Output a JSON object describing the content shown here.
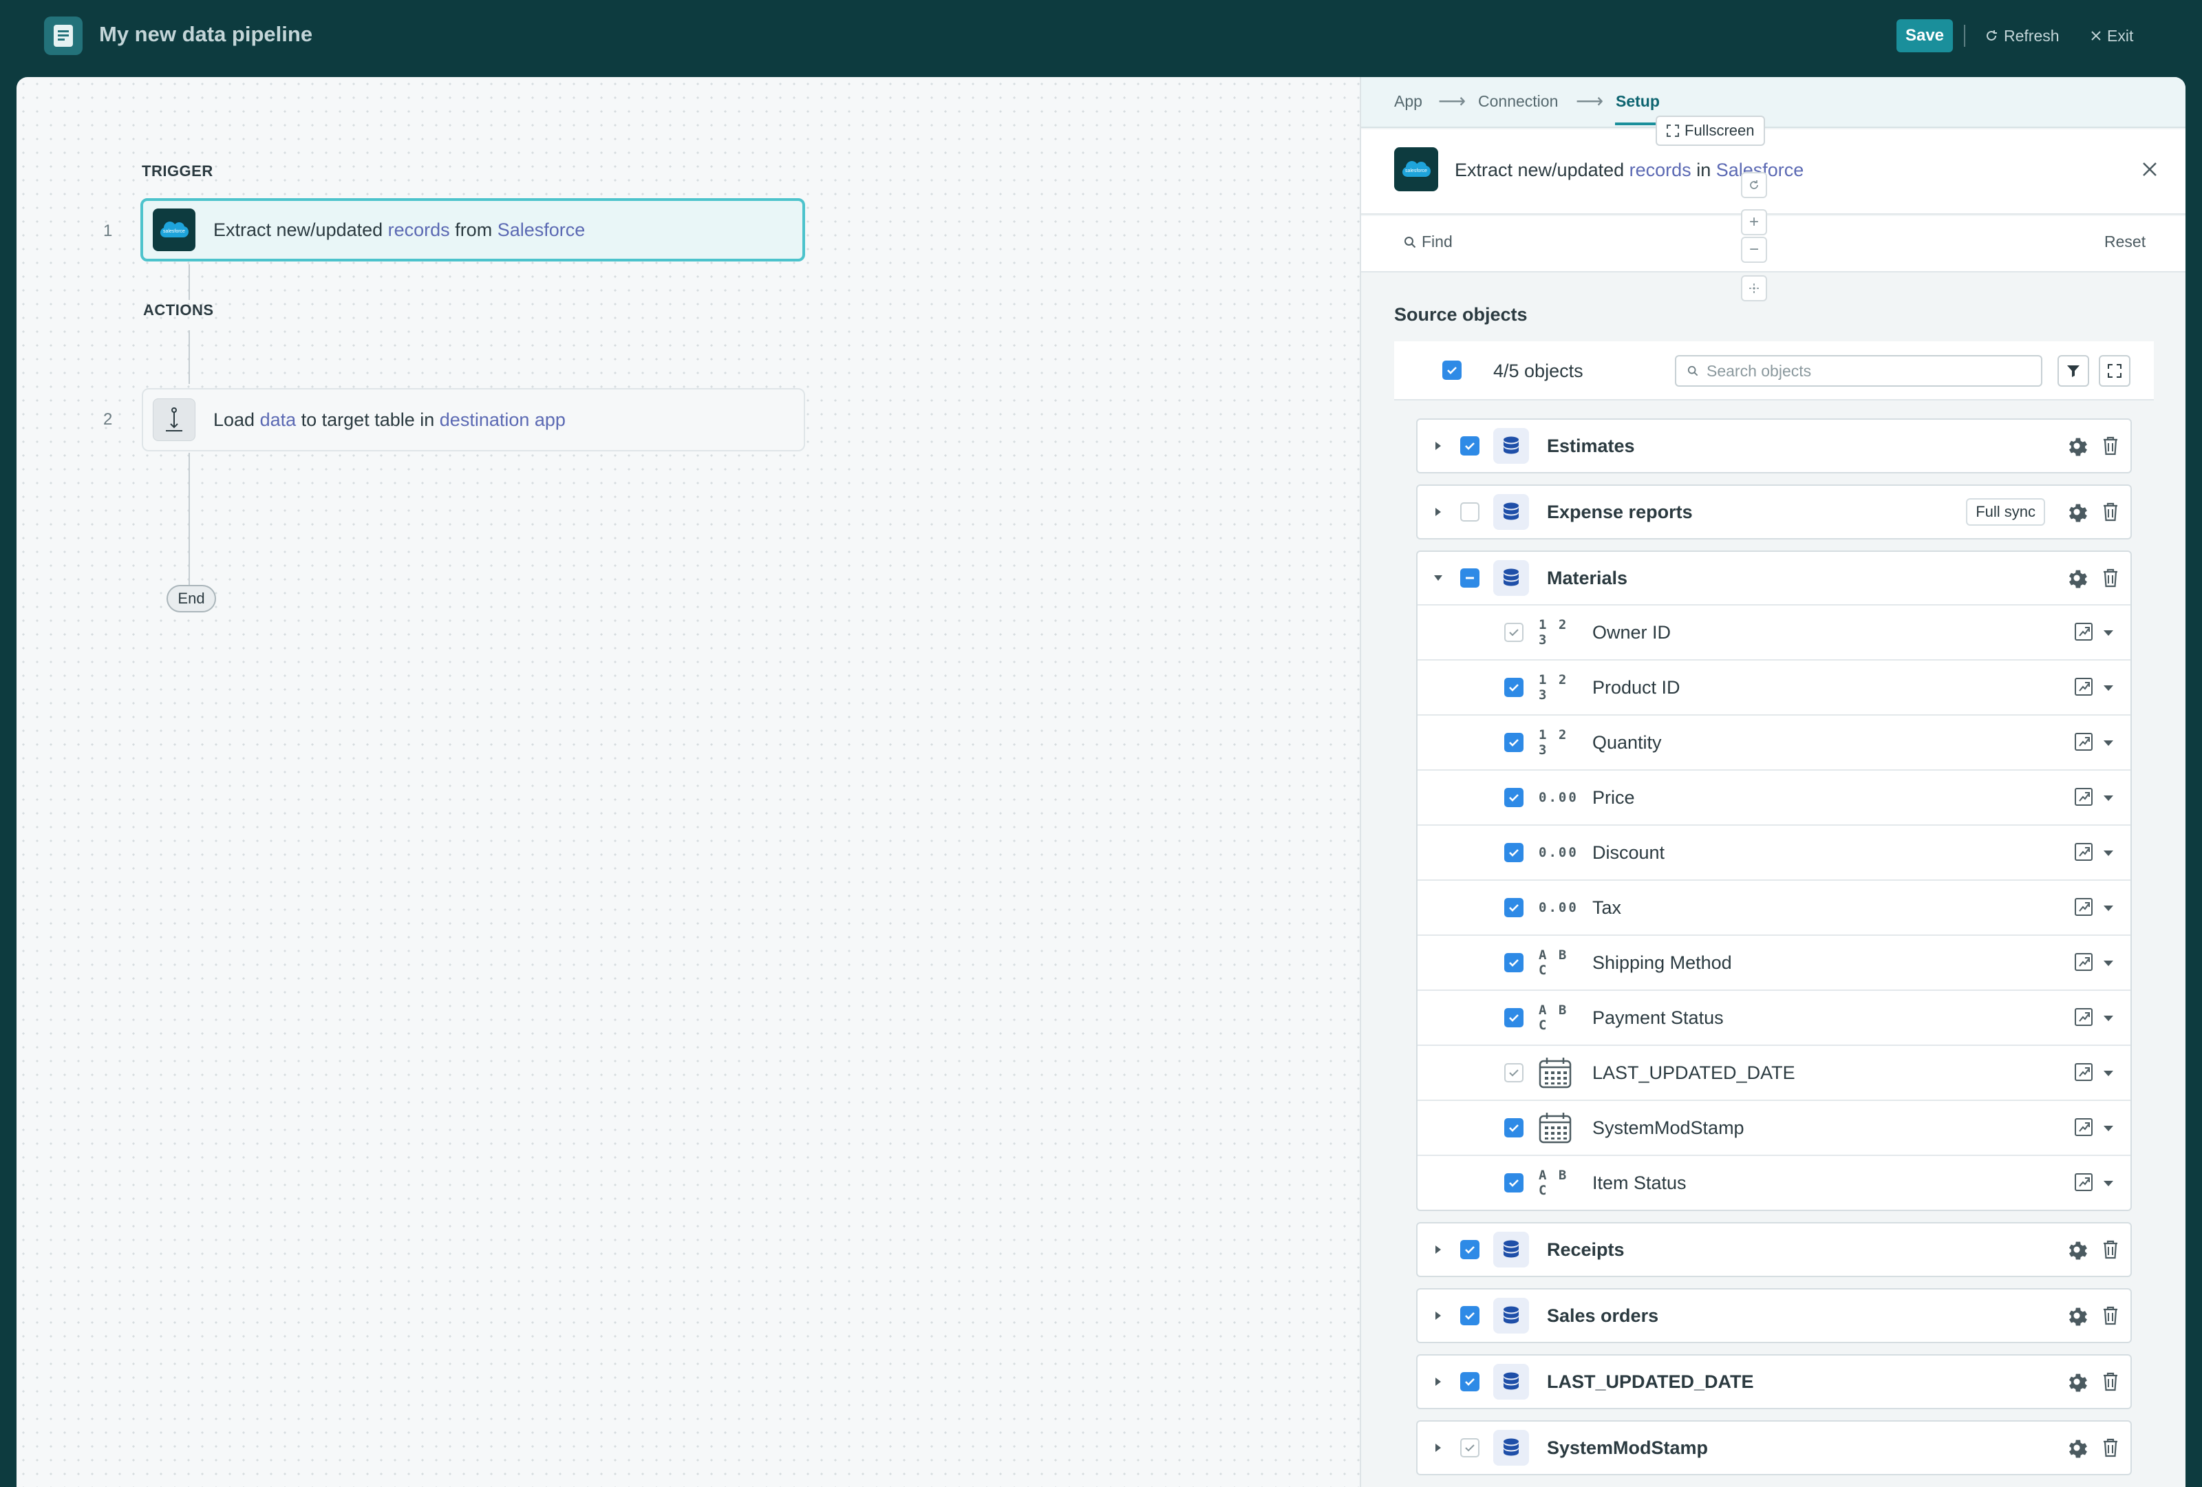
{
  "app": {
    "title": "My new data pipeline",
    "save_label": "Save",
    "refresh_label": "Refresh",
    "exit_label": "Exit"
  },
  "canvas": {
    "trigger_label": "TRIGGER",
    "actions_label": "ACTIONS",
    "end_label": "End",
    "steps": [
      {
        "num": "1",
        "pre": "Extract new/updated ",
        "link1": "records",
        "mid": " from ",
        "link2": "Salesforce",
        "post": ""
      },
      {
        "num": "2",
        "pre": "Load ",
        "link1": "data",
        "mid": " to target table in ",
        "link2": "destination app",
        "post": ""
      }
    ]
  },
  "panel": {
    "breadcrumbs": [
      "App",
      "Connection",
      "Setup"
    ],
    "fullscreen_label": "Fullscreen",
    "header": {
      "pre": "Extract new/updated ",
      "link1": "records",
      "mid": " in ",
      "link2": "Salesforce"
    },
    "find_label": "Find",
    "reset_label": "Reset",
    "source_title": "Source objects",
    "count_label": "4/5 objects",
    "search_placeholder": "Search objects",
    "objects": [
      {
        "name": "Estimates",
        "state": "on",
        "expanded": false
      },
      {
        "name": "Expense reports",
        "state": "off",
        "expanded": false,
        "badge": "Full sync"
      },
      {
        "name": "Materials",
        "state": "mixed",
        "expanded": true,
        "fields": [
          {
            "type": "123",
            "name": "Owner ID",
            "state": "dim"
          },
          {
            "type": "123",
            "name": "Product ID",
            "state": "on"
          },
          {
            "type": "123",
            "name": "Quantity",
            "state": "on"
          },
          {
            "type": "0.00",
            "name": "Price",
            "state": "on"
          },
          {
            "type": "0.00",
            "name": "Discount",
            "state": "on"
          },
          {
            "type": "0.00",
            "name": "Tax",
            "state": "on"
          },
          {
            "type": "ABC",
            "name": "Shipping Method",
            "state": "on"
          },
          {
            "type": "ABC",
            "name": "Payment Status",
            "state": "on"
          },
          {
            "type": "date",
            "name": "LAST_UPDATED_DATE",
            "state": "dim"
          },
          {
            "type": "date",
            "name": "SystemModStamp",
            "state": "on"
          },
          {
            "type": "ABC",
            "name": "Item Status",
            "state": "on"
          }
        ]
      },
      {
        "name": "Receipts",
        "state": "on",
        "expanded": false
      },
      {
        "name": "Sales orders",
        "state": "on",
        "expanded": false
      },
      {
        "name": "LAST_UPDATED_DATE",
        "state": "on",
        "expanded": false
      },
      {
        "name": "SystemModStamp",
        "state": "dim",
        "expanded": false
      }
    ]
  },
  "colors": {
    "brand": "#0d3b3f",
    "accent": "#1a8f9b",
    "link": "#5b69b3",
    "checkbox": "#2e8ae6"
  },
  "icons": [
    "document-icon",
    "refresh-icon",
    "close-icon",
    "salesforce-icon",
    "load-icon",
    "arrow-right-icon",
    "fullscreen-icon",
    "search-icon",
    "filter-icon",
    "expand-icon",
    "database-icon",
    "gear-icon",
    "trash-icon",
    "mapping-icon",
    "chevron-down-icon",
    "calendar-icon"
  ]
}
